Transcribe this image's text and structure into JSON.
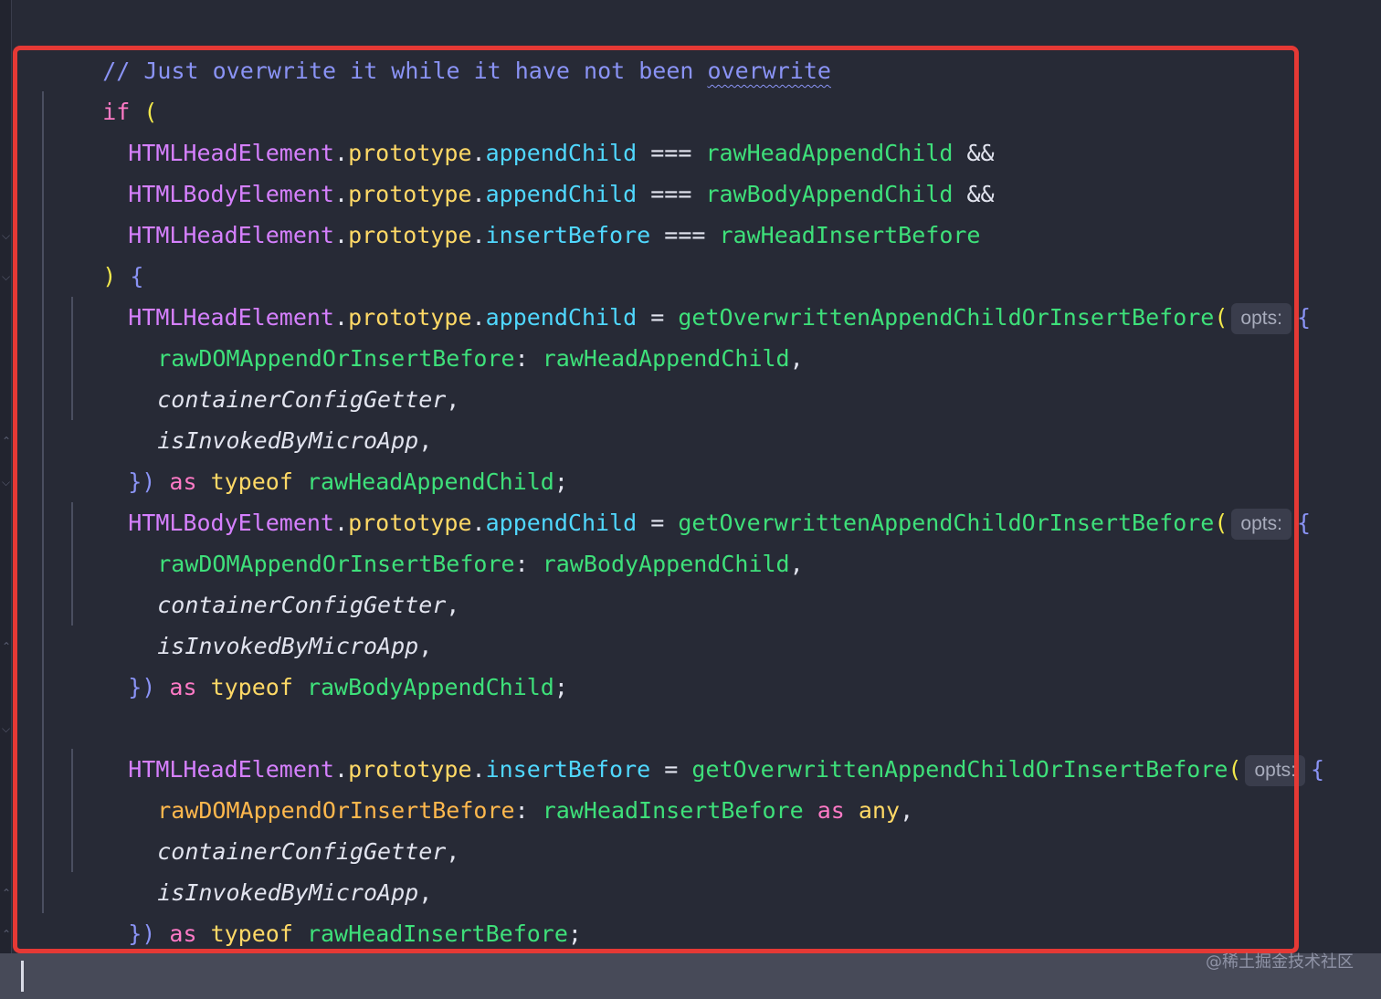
{
  "comment": {
    "prefix": "// Just overwrite it while it have not been ",
    "underlined": "overwrite"
  },
  "if_block": {
    "if_kw": "if",
    "open_paren": "(",
    "conditions": [
      {
        "cls": "HTMLHeadElement",
        "proto": "prototype",
        "method": "appendChild",
        "op": "===",
        "raw": "rawHeadAppendChild",
        "join": "&&"
      },
      {
        "cls": "HTMLBodyElement",
        "proto": "prototype",
        "method": "appendChild",
        "op": "===",
        "raw": "rawBodyAppendChild",
        "join": "&&"
      },
      {
        "cls": "HTMLHeadElement",
        "proto": "prototype",
        "method": "insertBefore",
        "op": "===",
        "raw": "rawHeadInsertBefore",
        "join": ""
      }
    ],
    "close_paren": ")",
    "open_brace": "{",
    "close_brace": "}"
  },
  "assignments": [
    {
      "cls": "HTMLHeadElement",
      "proto": "prototype",
      "method": "appendChild",
      "eq": "=",
      "fn": "getOverwrittenAppendChildOrInsertBefore",
      "paren": "(",
      "hint": "opts:",
      "brace_open": "{",
      "key": "rawDOMAppendOrInsertBefore",
      "colon": ":",
      "value": "rawHeadAppendChild",
      "comma": ",",
      "arg2": "containerConfigGetter",
      "arg3": "isInvokedByMicroApp",
      "closing": "})",
      "as": "as",
      "typeof": "typeof",
      "type_ref": "rawHeadAppendChild",
      "semi": ";"
    },
    {
      "cls": "HTMLBodyElement",
      "proto": "prototype",
      "method": "appendChild",
      "eq": "=",
      "fn": "getOverwrittenAppendChildOrInsertBefore",
      "paren": "(",
      "hint": "opts:",
      "brace_open": "{",
      "key": "rawDOMAppendOrInsertBefore",
      "colon": ":",
      "value": "rawBodyAppendChild",
      "comma": ",",
      "arg2": "containerConfigGetter",
      "arg3": "isInvokedByMicroApp",
      "closing": "})",
      "as": "as",
      "typeof": "typeof",
      "type_ref": "rawBodyAppendChild",
      "semi": ";"
    },
    {
      "cls": "HTMLHeadElement",
      "proto": "prototype",
      "method": "insertBefore",
      "eq": "=",
      "fn": "getOverwrittenAppendChildOrInsertBefore",
      "paren": "(",
      "hint": "opts:",
      "brace_open": "{",
      "key": "rawDOMAppendOrInsertBefore",
      "colon": ":",
      "value": "rawHeadInsertBefore",
      "value_as": "as",
      "value_any": "any",
      "comma": ",",
      "arg2": "containerConfigGetter",
      "arg3": "isInvokedByMicroApp",
      "closing": "})",
      "as": "as",
      "typeof": "typeof",
      "type_ref": "rawHeadInsertBefore",
      "semi": ";"
    }
  ],
  "gutter": {
    "fold_icon": "fold-chevron-icon"
  },
  "watermark": "@稀土掘金技术社区",
  "colors": {
    "background": "#272a36",
    "highlight_border": "#e53935",
    "comment": "#8a93f5",
    "keyword": "#ff7ac6",
    "class": "#d680ff",
    "property": "#ffd966",
    "method": "#50d8ff",
    "function": "#3ee07a"
  }
}
